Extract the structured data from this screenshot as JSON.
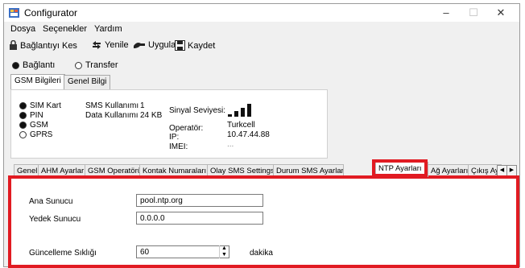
{
  "window": {
    "title": "Configurator",
    "controls": [
      "–",
      "☐",
      "✕"
    ]
  },
  "menu": [
    "Dosya",
    "Seçenekler",
    "Yardım"
  ],
  "toolbar": [
    {
      "label": "Bağlantıyı Kes",
      "icon": "disconnect-icon"
    },
    {
      "label": "Yenile",
      "icon": "refresh-icon"
    },
    {
      "label": "Uygula",
      "icon": "apply-icon"
    },
    {
      "label": "Kaydet",
      "icon": "save-icon"
    }
  ],
  "mode": {
    "selected": "Bağlantı",
    "options": [
      "Bağlantı",
      "Transfer"
    ]
  },
  "info_tabs": {
    "active": "GSM Bilgileri",
    "items": [
      "GSM Bilgileri",
      "Genel Bilgi"
    ]
  },
  "gsm_status": [
    {
      "label": "SIM Kart",
      "on": true
    },
    {
      "label": "PIN",
      "on": true
    },
    {
      "label": "GSM",
      "on": true
    },
    {
      "label": "GPRS",
      "on": false
    }
  ],
  "usage": {
    "sms_label": "SMS Kullanımı",
    "sms_value": "1",
    "data_label": "Data Kullanımı",
    "data_value": "24 KB"
  },
  "signal": {
    "label": "Sinyal Seviyesi:",
    "level_bars": 4,
    "max_bars": 5
  },
  "network": {
    "operator_label": "Operatör:",
    "operator_value": "Turkcell",
    "ip_label": "IP:",
    "ip_value": "10.47.44.88",
    "imei_label": "IMEI:",
    "imei_value": "..."
  },
  "settings_tabs": {
    "active": "NTP Ayarları",
    "items": [
      "Genel",
      "AHM Ayarları",
      "GSM Operatörü",
      "Kontak Numaraları",
      "Olay SMS Settings",
      "Durum SMS Ayarları",
      "NTP Ayarları",
      "Ağ Ayarları",
      "Çıkış Ay"
    ]
  },
  "ntp": {
    "primary_label": "Ana Sunucu",
    "primary_value": "pool.ntp.org",
    "backup_label": "Yedek Sunucu",
    "backup_value": "0.0.0.0",
    "interval_label": "Güncelleme Sıklığı",
    "interval_value": "60",
    "interval_unit": "dakika"
  },
  "colors": {
    "highlight": "#e11b22"
  }
}
